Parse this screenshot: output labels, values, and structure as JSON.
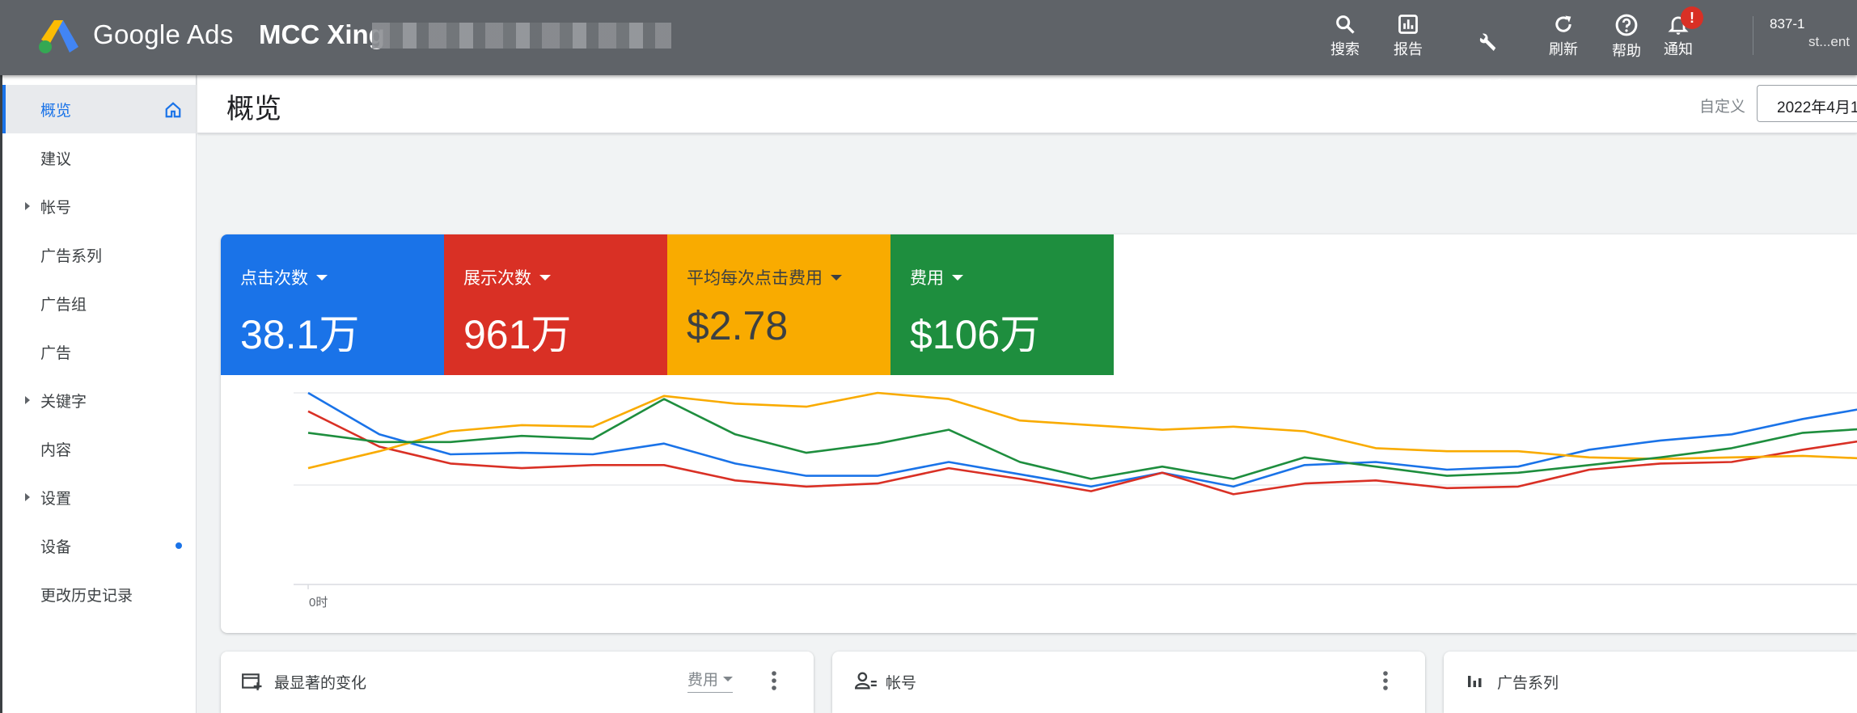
{
  "header": {
    "brand": "Google Ads",
    "account_name": "MCC Xing",
    "buttons": [
      {
        "label": "搜索",
        "icon": "search-icon"
      },
      {
        "label": "报告",
        "icon": "reports-icon"
      },
      {
        "label": "工具和\n设置",
        "icon": "wrench-icon"
      },
      {
        "label": "刷新",
        "icon": "refresh-icon"
      },
      {
        "label": "帮助",
        "icon": "help-icon"
      },
      {
        "label": "通知",
        "icon": "bell-icon"
      }
    ],
    "notification_badge": "!",
    "customer_id": "837-1",
    "customer_sub": "st...ent"
  },
  "sidebar": {
    "items": [
      {
        "label": "概览",
        "active": true
      },
      {
        "label": "建议"
      },
      {
        "label": "帐号",
        "expandable": true
      },
      {
        "label": "广告系列"
      },
      {
        "label": "广告组"
      },
      {
        "label": "广告"
      },
      {
        "label": "关键字",
        "expandable": true
      },
      {
        "label": "内容"
      },
      {
        "label": "设置",
        "expandable": true
      },
      {
        "label": "设备"
      },
      {
        "label": "更改历史记录"
      }
    ]
  },
  "page": {
    "title": "概览",
    "custom_label": "自定义",
    "date_range": "2022年4月1"
  },
  "metrics": [
    {
      "label": "点击次数",
      "value": "38.1万",
      "color": "#1a73e8"
    },
    {
      "label": "展示次数",
      "value": "961万",
      "color": "#d93025"
    },
    {
      "label": "平均每次点击费用",
      "value": "$2.78",
      "color": "#f9ab00"
    },
    {
      "label": "费用",
      "value": "$106万",
      "color": "#1e8e3e"
    }
  ],
  "chart_data": {
    "type": "line",
    "x_label_first": "0时",
    "series": [
      {
        "name": "点击次数",
        "color": "#1a73e8",
        "values": [
          100,
          73,
          60,
          61,
          60,
          67,
          54,
          46,
          46,
          55,
          47,
          39,
          48,
          39,
          53,
          55,
          50,
          52,
          63,
          69,
          73,
          83,
          91
        ]
      },
      {
        "name": "展示次数",
        "color": "#d93025",
        "values": [
          88,
          65,
          54,
          51,
          53,
          53,
          43,
          39,
          41,
          51,
          44,
          36,
          48,
          34,
          41,
          43,
          38,
          39,
          50,
          54,
          55,
          63,
          70
        ]
      },
      {
        "name": "平均每次点击费用",
        "color": "#f9ab00",
        "values": [
          51,
          62,
          75,
          79,
          78,
          98,
          93,
          91,
          100,
          96,
          82,
          79,
          76,
          78,
          75,
          64,
          62,
          62,
          58,
          57,
          58,
          59,
          57
        ]
      },
      {
        "name": "费用",
        "color": "#1e8e3e",
        "values": [
          74,
          68,
          68,
          72,
          70,
          96,
          73,
          61,
          67,
          76,
          55,
          44,
          52,
          44,
          58,
          52,
          46,
          48,
          53,
          58,
          64,
          74,
          77
        ]
      }
    ]
  },
  "panels": [
    {
      "title": "最显著的变化",
      "icon": "add-window-icon",
      "select": "费用"
    },
    {
      "title": "帐号",
      "icon": "accounts-icon"
    },
    {
      "title": "广告系列",
      "icon": "bar-chart-icon"
    }
  ]
}
